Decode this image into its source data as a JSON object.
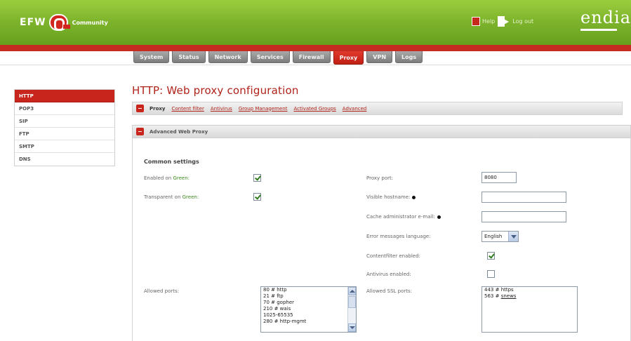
{
  "header": {
    "logo_text": "EFW",
    "logo_subtitle": "Community",
    "help_label": "Help",
    "logout_label": "Log out",
    "brand": "endian",
    "colors": {
      "header_green": "#7fb52d",
      "accent_red": "#c8261c"
    }
  },
  "nav": {
    "tabs": [
      {
        "label": "System"
      },
      {
        "label": "Status"
      },
      {
        "label": "Network"
      },
      {
        "label": "Services"
      },
      {
        "label": "Firewall"
      },
      {
        "label": "Proxy"
      },
      {
        "label": "VPN"
      },
      {
        "label": "Logs"
      }
    ],
    "active": "Proxy"
  },
  "sidebar": {
    "items": [
      {
        "label": "HTTP"
      },
      {
        "label": "POP3"
      },
      {
        "label": "SIP"
      },
      {
        "label": "FTP"
      },
      {
        "label": "SMTP"
      },
      {
        "label": "DNS"
      }
    ],
    "active": "HTTP"
  },
  "page": {
    "title": "HTTP: Web proxy configuration",
    "subtabs": [
      {
        "label": "Proxy"
      },
      {
        "label": "Content filter"
      },
      {
        "label": "Antivirus"
      },
      {
        "label": "Group Management"
      },
      {
        "label": "Activated Groups"
      },
      {
        "label": "Advanced"
      }
    ],
    "section_title": "Advanced Web Proxy",
    "group_title": "Common settings"
  },
  "form": {
    "enabled_on_prefix": "Enabled on ",
    "enabled_on_zone": "Green:",
    "enabled_on_checked": true,
    "transparent_prefix": "Transparent on ",
    "transparent_zone": "Green:",
    "transparent_checked": true,
    "proxy_port_label": "Proxy port:",
    "proxy_port_value": "8080",
    "visible_hostname_label": "Visible hostname:",
    "visible_hostname_value": "",
    "cache_admin_label": "Cache administrator e-mail:",
    "cache_admin_value": "",
    "error_lang_label": "Error messages language:",
    "error_lang_value": "English",
    "contentfilter_label": "Contentfilter enabled:",
    "contentfilter_checked": true,
    "antivirus_label": "Antivirus enabled:",
    "antivirus_checked": false,
    "allowed_ports_label": "Allowed ports:",
    "allowed_ports": [
      "80 # http",
      "21 # ftp",
      "70 # gopher",
      "210 # wais",
      "1025-65535",
      "280 # http-mgmt"
    ],
    "allowed_ssl_label": "Allowed SSL ports:",
    "allowed_ssl_ports": [
      {
        "num": "443 # ",
        "name": "https"
      },
      {
        "num": "563 # ",
        "name": "snews"
      }
    ]
  }
}
